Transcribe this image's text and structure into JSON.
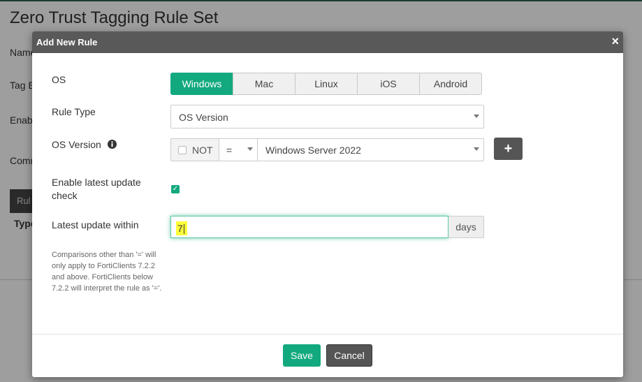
{
  "background": {
    "page_title": "Zero Trust Tagging Rule Set",
    "labels": [
      "Name",
      "Tag E",
      "Enab",
      "Comm"
    ],
    "tab_label": "Rul",
    "column_type": "Type"
  },
  "modal": {
    "title": "Add New Rule",
    "close_glyph": "×",
    "os": {
      "label": "OS",
      "options": [
        "Windows",
        "Mac",
        "Linux",
        "iOS",
        "Android"
      ],
      "selected": "Windows"
    },
    "rule_type": {
      "label": "Rule Type",
      "value": "OS Version"
    },
    "os_version": {
      "label": "OS Version",
      "info_icon": "info-circle-icon",
      "not_label": "NOT",
      "operator": "=",
      "value": "Windows Server 2022",
      "add_glyph": "+"
    },
    "latest_update_check": {
      "label": "Enable latest update check",
      "checked": true,
      "check_glyph": "✓"
    },
    "latest_update_within": {
      "label": "Latest update within",
      "value": "7",
      "unit": "days"
    },
    "help_text": "Comparisons other than '=' will only apply to FortiClients 7.2.2 and above. FortiClients below 7.2.2 will interpret the rule as '='.",
    "buttons": {
      "save": "Save",
      "cancel": "Cancel"
    }
  },
  "colors": {
    "accent": "#12a97f",
    "header": "#595959",
    "highlight": "#fdff3a"
  }
}
